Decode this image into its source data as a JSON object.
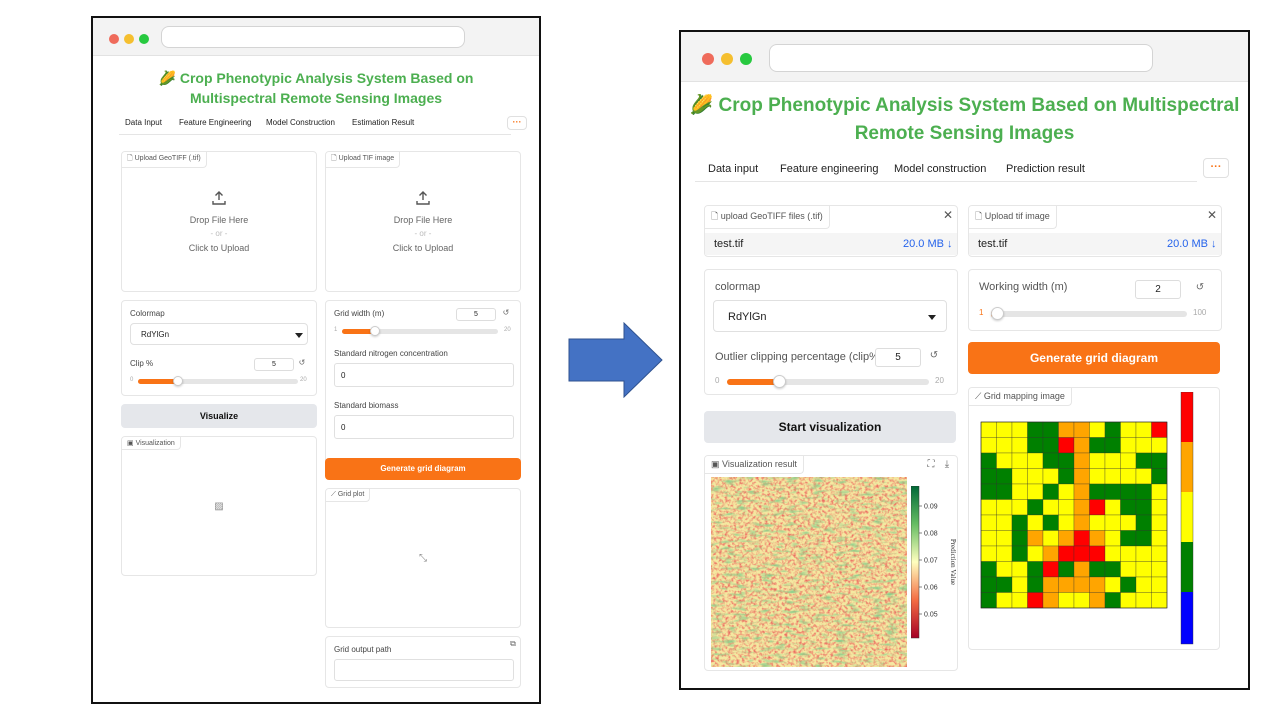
{
  "before": {
    "title": "🌽 Crop Phenotypic Analysis System Based on Multispectral Remote Sensing Images",
    "tabs": [
      "Data Input",
      "Feature Engineering",
      "Model Construction",
      "Estimation Result"
    ],
    "more": "···",
    "upload_geotiff": {
      "label": "Upload GeoTIFF (.tif)",
      "drop": "Drop File Here",
      "or": "- or -",
      "click": "Click to Upload"
    },
    "upload_tif": {
      "label": "Upload TIF image",
      "drop": "Drop File Here",
      "or": "- or -",
      "click": "Click to Upload"
    },
    "colormap": {
      "label": "Colormap",
      "value": "RdYlGn"
    },
    "clip": {
      "label": "Clip %",
      "value": "5",
      "min": "0",
      "max": "20",
      "fraction": 0.25
    },
    "grid_width": {
      "label": "Grid width (m)",
      "value": "5",
      "min": "1",
      "max": "20",
      "fraction": 0.21
    },
    "nitrogen": {
      "label": "Standard nitrogen concentration",
      "value": "0"
    },
    "biomass": {
      "label": "Standard biomass",
      "value": "0"
    },
    "visualize_button": "Visualize",
    "visualization_label": "Visualization",
    "generate_button": "Generate grid diagram",
    "grid_plot_label": "Grid plot",
    "grid_output_label": "Grid output path"
  },
  "after": {
    "title_line1": "Crop Phenotypic Analysis System Based on Multispectral",
    "title_line2": "Remote Sensing Images",
    "title_icon": "🌽",
    "tabs": [
      "Data input",
      "Feature engineering",
      "Model construction",
      "Prediction result"
    ],
    "more": "···",
    "upload_geotiff": {
      "label": "upload GeoTIFF files (.tif)",
      "file": "test.tif",
      "size": "20.0 MB ↓"
    },
    "upload_tif": {
      "label": "Upload tif image",
      "file": "test.tif",
      "size": "20.0 MB ↓"
    },
    "colormap": {
      "label": "colormap",
      "value": "RdYlGn"
    },
    "clip": {
      "label": "Outlier clipping percentage (clip%)",
      "value": "5",
      "min": "0",
      "max": "20",
      "fraction": 0.25
    },
    "working_width": {
      "label": "Working width (m)",
      "value": "2",
      "min": "1",
      "max": "100",
      "fraction": 0.01
    },
    "start_button": "Start visualization",
    "generate_button": "Generate grid diagram",
    "vis_result_label": "Visualization result",
    "grid_mapping_label": "Grid mapping image",
    "colorbar_ticks": [
      "0.09",
      "0.08",
      "0.07",
      "0.06",
      "0.05"
    ],
    "colorbar_title": "Prediction Value"
  },
  "icons": {
    "upload": "upload-icon",
    "file": "file-icon",
    "image": "image-icon",
    "close": "close-icon",
    "reset": "reset-icon",
    "copy": "copy-icon",
    "fullscreen": "fullscreen-icon",
    "download": "download-icon",
    "arrow": "right-arrow"
  },
  "colors": {
    "accent": "#f97316",
    "title_green": "#4caf50",
    "arrow_blue": "#4472c4",
    "link_blue": "#2563eb"
  }
}
